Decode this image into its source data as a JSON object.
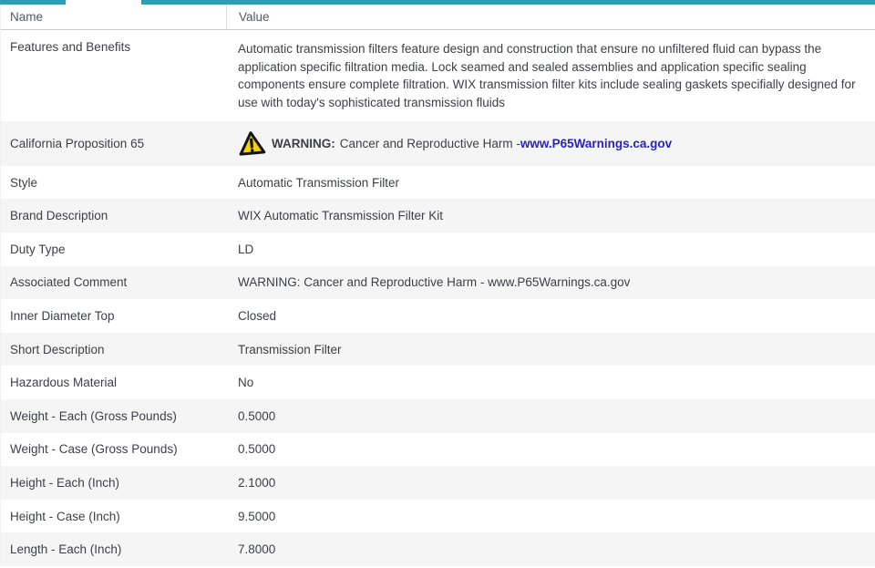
{
  "colors": {
    "accent_teal": "#2d9eb8",
    "link_blue": "#2a22bd",
    "warning_yellow": "#f2d10e",
    "alt_row_bg": "#f5f5f5"
  },
  "header": {
    "name_col": "Name",
    "value_col": "Value"
  },
  "rows": [
    {
      "name": "Features and Benefits",
      "value": "Automatic transmission filters feature design and construction that ensure no unfiltered fluid can bypass the application specific filtration media. Lock seamed and sealed assemblies and application specific sealing components ensure complete filtration. WIX transmission filter kits include sealing gaskets specifially designed for use with today's sophisticated transmission fluids"
    },
    {
      "name": "California Proposition 65",
      "warning": {
        "icon": "warning-triangle-icon",
        "label": "WARNING:",
        "text": "Cancer and Reproductive Harm - ",
        "link": "www.P65Warnings.ca.gov"
      }
    },
    {
      "name": "Style",
      "value": "Automatic Transmission Filter"
    },
    {
      "name": "Brand Description",
      "value": "WIX Automatic Transmission Filter Kit"
    },
    {
      "name": "Duty Type",
      "value": "LD"
    },
    {
      "name": "Associated Comment",
      "value": "WARNING: Cancer and Reproductive Harm - www.P65Warnings.ca.gov"
    },
    {
      "name": "Inner Diameter Top",
      "value": "Closed"
    },
    {
      "name": "Short Description",
      "value": "Transmission Filter"
    },
    {
      "name": "Hazardous Material",
      "value": "No"
    },
    {
      "name": "Weight - Each (Gross Pounds)",
      "value": "0.5000"
    },
    {
      "name": "Weight - Case (Gross Pounds)",
      "value": "0.5000"
    },
    {
      "name": "Height - Each (Inch)",
      "value": "2.1000"
    },
    {
      "name": "Height - Case (Inch)",
      "value": "9.5000"
    },
    {
      "name": "Length - Each (Inch)",
      "value": "7.8000"
    }
  ]
}
